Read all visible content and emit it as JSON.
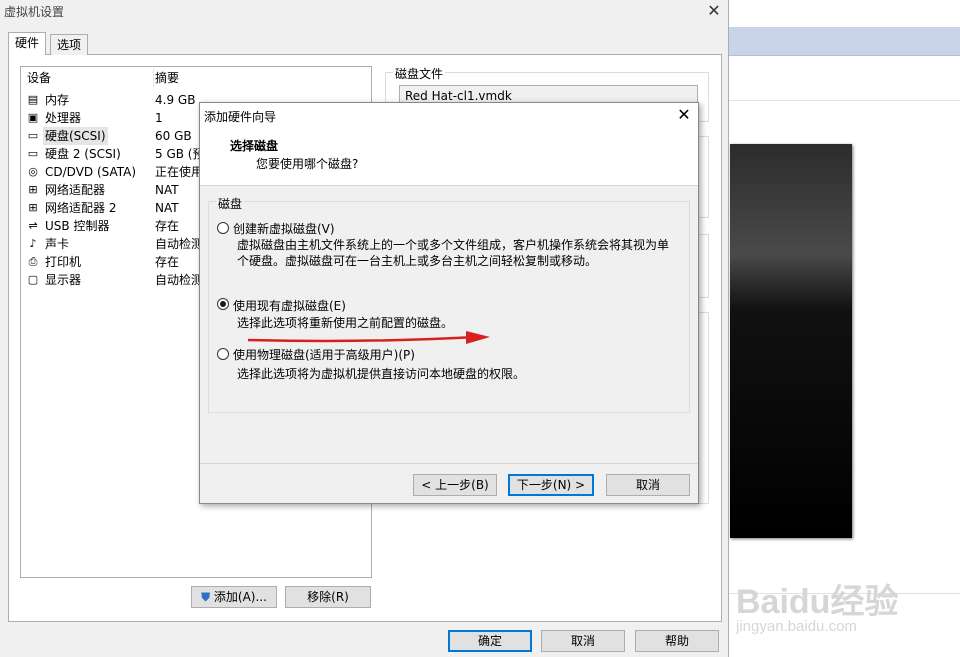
{
  "window": {
    "title": "虚拟机设置",
    "close": "✕"
  },
  "tabs": [
    {
      "label": "硬件"
    },
    {
      "label": "选项"
    }
  ],
  "device_list": {
    "columns": {
      "device": "设备",
      "summary": "摘要"
    },
    "rows": [
      {
        "icon": "memory-icon",
        "glyph": "▤",
        "name": "内存",
        "summary": "4.9 GB"
      },
      {
        "icon": "processor-icon",
        "glyph": "▣",
        "name": "处理器",
        "summary": "1"
      },
      {
        "icon": "hard-disk-icon",
        "glyph": "▭",
        "name": "硬盘(SCSI)",
        "summary": "60 GB"
      },
      {
        "icon": "hard-disk-icon",
        "glyph": "▭",
        "name": "硬盘 2 (SCSI)",
        "summary": "5 GB (预"
      },
      {
        "icon": "cd-dvd-icon",
        "glyph": "◎",
        "name": "CD/DVD (SATA)",
        "summary": "正在使用"
      },
      {
        "icon": "network-adapter-icon",
        "glyph": "⊞",
        "name": "网络适配器",
        "summary": "NAT"
      },
      {
        "icon": "network-adapter-icon",
        "glyph": "⊞",
        "name": "网络适配器 2",
        "summary": "NAT"
      },
      {
        "icon": "usb-controller-icon",
        "glyph": "⇌",
        "name": "USB 控制器",
        "summary": "存在"
      },
      {
        "icon": "sound-card-icon",
        "glyph": "♪",
        "name": "声卡",
        "summary": "自动检测"
      },
      {
        "icon": "printer-icon",
        "glyph": "⎙",
        "name": "打印机",
        "summary": "存在"
      },
      {
        "icon": "display-icon",
        "glyph": "▢",
        "name": "显示器",
        "summary": "自动检测"
      }
    ],
    "selected_index": 2
  },
  "buttons": {
    "add": "添加(A)...",
    "remove": "移除(R)",
    "ok": "确定",
    "cancel": "取消",
    "help": "帮助"
  },
  "disk_file": {
    "label": "磁盘文件",
    "value": "Red Hat-cl1.vmdk"
  },
  "wizard": {
    "title": "添加硬件向导",
    "close": "✕",
    "heading": "选择磁盘",
    "subheading": "您要使用哪个磁盘?",
    "group_label": "磁盘",
    "options": [
      {
        "label": "创建新虚拟磁盘(V)",
        "desc": "虚拟磁盘由主机文件系统上的一个或多个文件组成，客户机操作系统会将其视为单个硬盘。虚拟磁盘可在一台主机上或多台主机之间轻松复制或移动。",
        "checked": false
      },
      {
        "label": "使用现有虚拟磁盘(E)",
        "desc": "选择此选项将重新使用之前配置的磁盘。",
        "checked": true
      },
      {
        "label": "使用物理磁盘(适用于高级用户)(P)",
        "desc": "选择此选项将为虚拟机提供直接访问本地硬盘的权限。",
        "checked": false
      }
    ],
    "buttons": {
      "back": "< 上一步(B)",
      "next": "下一步(N) >",
      "cancel": "取消"
    }
  },
  "annotation": {
    "arrow_color": "#d9201f"
  },
  "watermark": {
    "logo": "Baidu经验",
    "url": "jingyan.baidu.com"
  }
}
